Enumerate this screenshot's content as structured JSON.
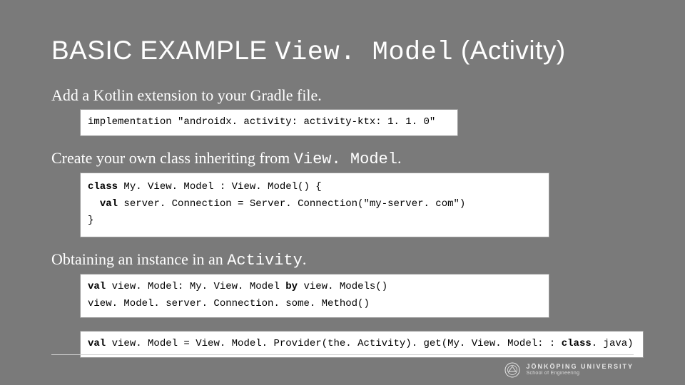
{
  "title": {
    "pre": "BASIC EXAMPLE ",
    "mono": "View. Model",
    "post": " (Activity)"
  },
  "section1": {
    "text": "Add a Kotlin extension to your Gradle file.",
    "code_line1": "implementation \"androidx. activity: activity-ktx: 1. 1. 0\""
  },
  "section2": {
    "pre": "Create your own class inheriting from ",
    "mono": "View. Model",
    "post": ".",
    "code": {
      "kw1": "class",
      "l1_rest": " My. View. Model : View. Model() {",
      "indent": "  ",
      "kw2": "val",
      "l2_rest": " server. Connection = Server. Connection(\"my-server. com\")",
      "l3": "}"
    }
  },
  "section3": {
    "pre": "Obtaining an instance in an ",
    "mono": "Activity",
    "post": ".",
    "code1": {
      "kw1": "val",
      "mid1": " view. Model: My. View. Model ",
      "kw2": "by",
      "rest1": " view. Models()",
      "line2": "view. Model. server. Connection. some. Method()"
    },
    "code2": {
      "kw1": "val",
      "mid": " view. Model = View. Model. Provider(the. Activity). get(My. View. Model: : ",
      "kw2": "class",
      "rest": ". java)"
    }
  },
  "footer": {
    "uni": "JÖNKÖPING UNIVERSITY",
    "school": "School of Engineering"
  }
}
